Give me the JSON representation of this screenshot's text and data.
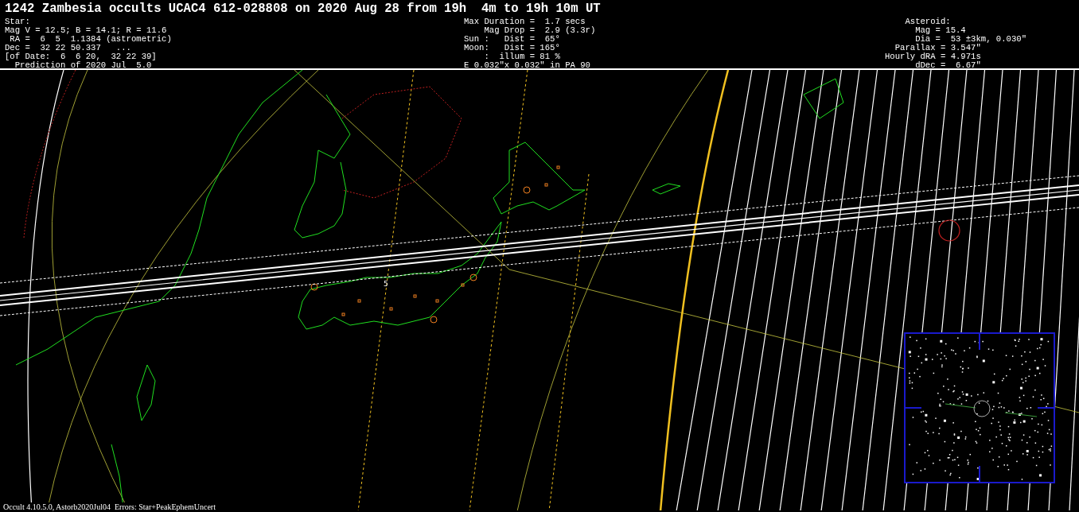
{
  "title": "1242 Zambesia occults UCAC4 612-028808 on 2020 Aug 28 from 19h  4m to 19h 10m UT",
  "star_info": [
    "Star:",
    "Mag V = 12.5; B = 14.1; R = 11.6",
    " RA =  6  5  1.1384 (astrometric)",
    "Dec =  32 22 50.337   ...",
    "[of Date:  6  6 20,  32 22 39]",
    "  Prediction of 2020 Jul  5.0"
  ],
  "event_info": [
    "Max Duration =  1.7 secs",
    "    Mag Drop =  2.9 (3.3r)",
    "Sun :   Dist =  65°",
    "Moon:   Dist = 165°",
    "    :  illum = 81 %",
    "E 0.032\"x 0.032\" in PA 90"
  ],
  "asteroid_info": [
    "    Asteroid:",
    "      Mag = 15.4",
    "      Dia =  53 ±3km, 0.030\"",
    "  Parallax = 3.547\"",
    "Hourly dRA = 4.971s",
    "      dDec =  6.67\""
  ],
  "map": {
    "path_label": "5"
  },
  "footer": "Occult 4.10.5.0, Astorb2020Jul04  Errors: Star+PeakEphemUncert"
}
